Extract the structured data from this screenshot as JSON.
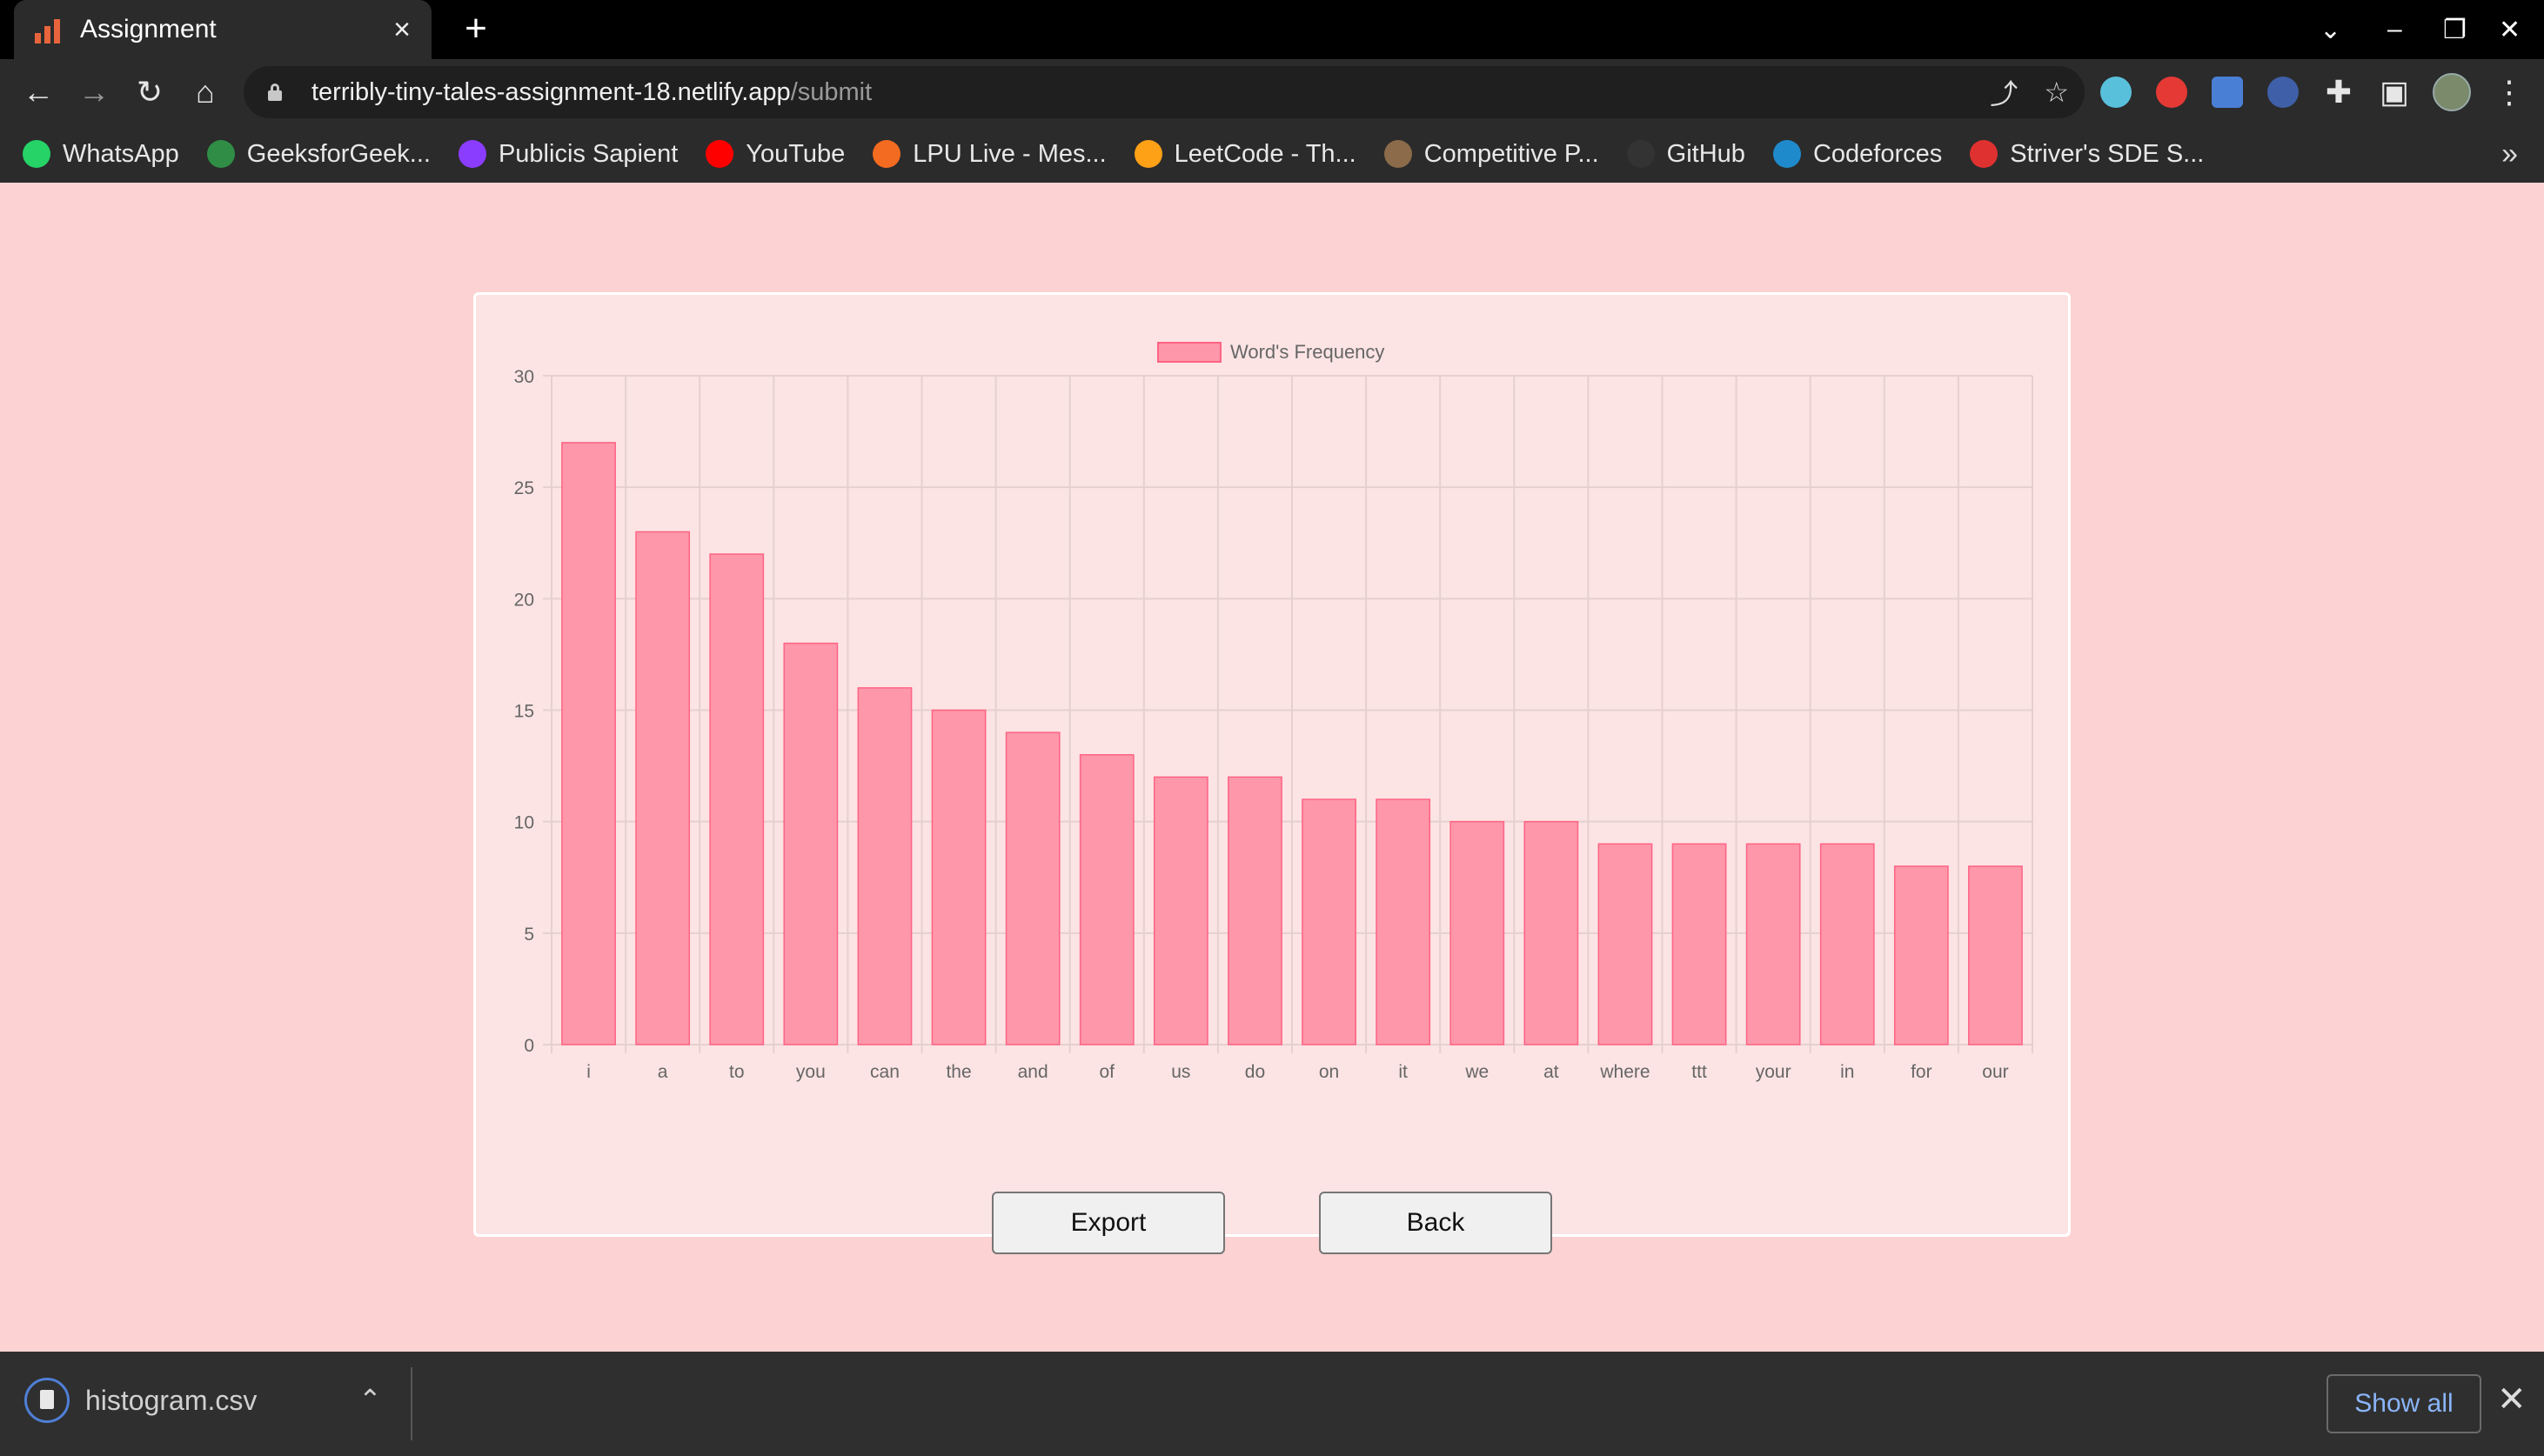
{
  "browser": {
    "tab_title": "Assignment",
    "tab_close": "×",
    "new_tab": "+",
    "url_host": "terribly-tiny-tales-assignment-18.netlify.app",
    "url_path": "/submit",
    "bookmarks": [
      {
        "label": "WhatsApp",
        "icon": "whatsapp-icon",
        "color": "#25d366"
      },
      {
        "label": "GeeksforGeek...",
        "icon": "gfg-icon",
        "color": "#2f8d46"
      },
      {
        "label": "Publicis Sapient",
        "icon": "publicis-icon",
        "color": "#8b3dff"
      },
      {
        "label": "YouTube",
        "icon": "youtube-icon",
        "color": "#ff0000"
      },
      {
        "label": "LPU Live - Mes...",
        "icon": "lpu-icon",
        "color": "#f36b21"
      },
      {
        "label": "LeetCode - Th...",
        "icon": "leetcode-icon",
        "color": "#ffa116"
      },
      {
        "label": "Competitive P...",
        "icon": "cc-icon",
        "color": "#8b6b4a"
      },
      {
        "label": "GitHub",
        "icon": "github-icon",
        "color": "#333333"
      },
      {
        "label": "Codeforces",
        "icon": "codeforces-icon",
        "color": "#1f8acb"
      },
      {
        "label": "Striver's SDE S...",
        "icon": "striver-icon",
        "color": "#e03131"
      }
    ]
  },
  "page": {
    "export_label": "Export",
    "back_label": "Back"
  },
  "chart_data": {
    "type": "bar",
    "categories": [
      "i",
      "a",
      "to",
      "you",
      "can",
      "the",
      "and",
      "of",
      "us",
      "do",
      "on",
      "it",
      "we",
      "at",
      "where",
      "ttt",
      "your",
      "in",
      "for",
      "our"
    ],
    "series": [
      {
        "name": "Word's Frequency",
        "values": [
          27,
          23,
          22,
          18,
          16,
          15,
          14,
          13,
          12,
          12,
          11,
          11,
          10,
          10,
          9,
          9,
          9,
          9,
          8,
          8
        ]
      }
    ],
    "ylim": [
      0,
      30
    ],
    "yticks": [
      0,
      5,
      10,
      15,
      20,
      25,
      30
    ],
    "legend": "top-center",
    "grid": true,
    "bar_fill": "#fe97aa",
    "bar_border": "#ff6384"
  },
  "downloads": {
    "file_name": "histogram.csv",
    "show_all": "Show all"
  }
}
